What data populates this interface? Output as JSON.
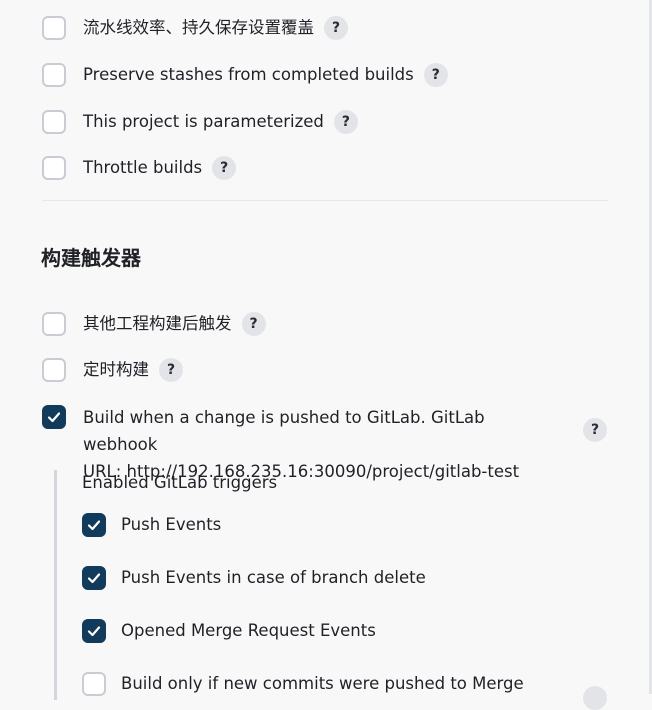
{
  "general": {
    "items": [
      {
        "label": "流水线效率、持久保存设置覆盖",
        "checked": false,
        "help": "?"
      },
      {
        "label": "Preserve stashes from completed builds",
        "checked": false,
        "help": "?"
      },
      {
        "label": "This project is parameterized",
        "checked": false,
        "help": "?"
      },
      {
        "label": "Throttle builds",
        "checked": false,
        "help": "?"
      }
    ]
  },
  "triggers": {
    "title": "构建触发器",
    "items": [
      {
        "label": "其他工程构建后触发",
        "checked": false,
        "help": "?"
      },
      {
        "label": "定时构建",
        "checked": false,
        "help": "?"
      }
    ],
    "gitlab": {
      "line1": "Build when a change is pushed to GitLab. GitLab webhook",
      "line2": "URL: http://192.168.235.16:30090/project/gitlab-test",
      "checked": true,
      "help": "?",
      "enabled_title": "Enabled GitLab triggers",
      "sub_items": [
        {
          "label": "Push Events",
          "checked": true
        },
        {
          "label": "Push Events in case of branch delete",
          "checked": true
        },
        {
          "label": "Opened Merge Request Events",
          "checked": true
        },
        {
          "label": "Build only if new commits were pushed to Merge",
          "checked": false
        }
      ]
    }
  },
  "colors": {
    "checked": "#123a5b",
    "unchecked_border": "#c9ccd3",
    "help_bg": "#e3e4e8",
    "background": "#f8f8f9"
  },
  "icons": {
    "check": "check-icon",
    "help": "help-icon"
  }
}
